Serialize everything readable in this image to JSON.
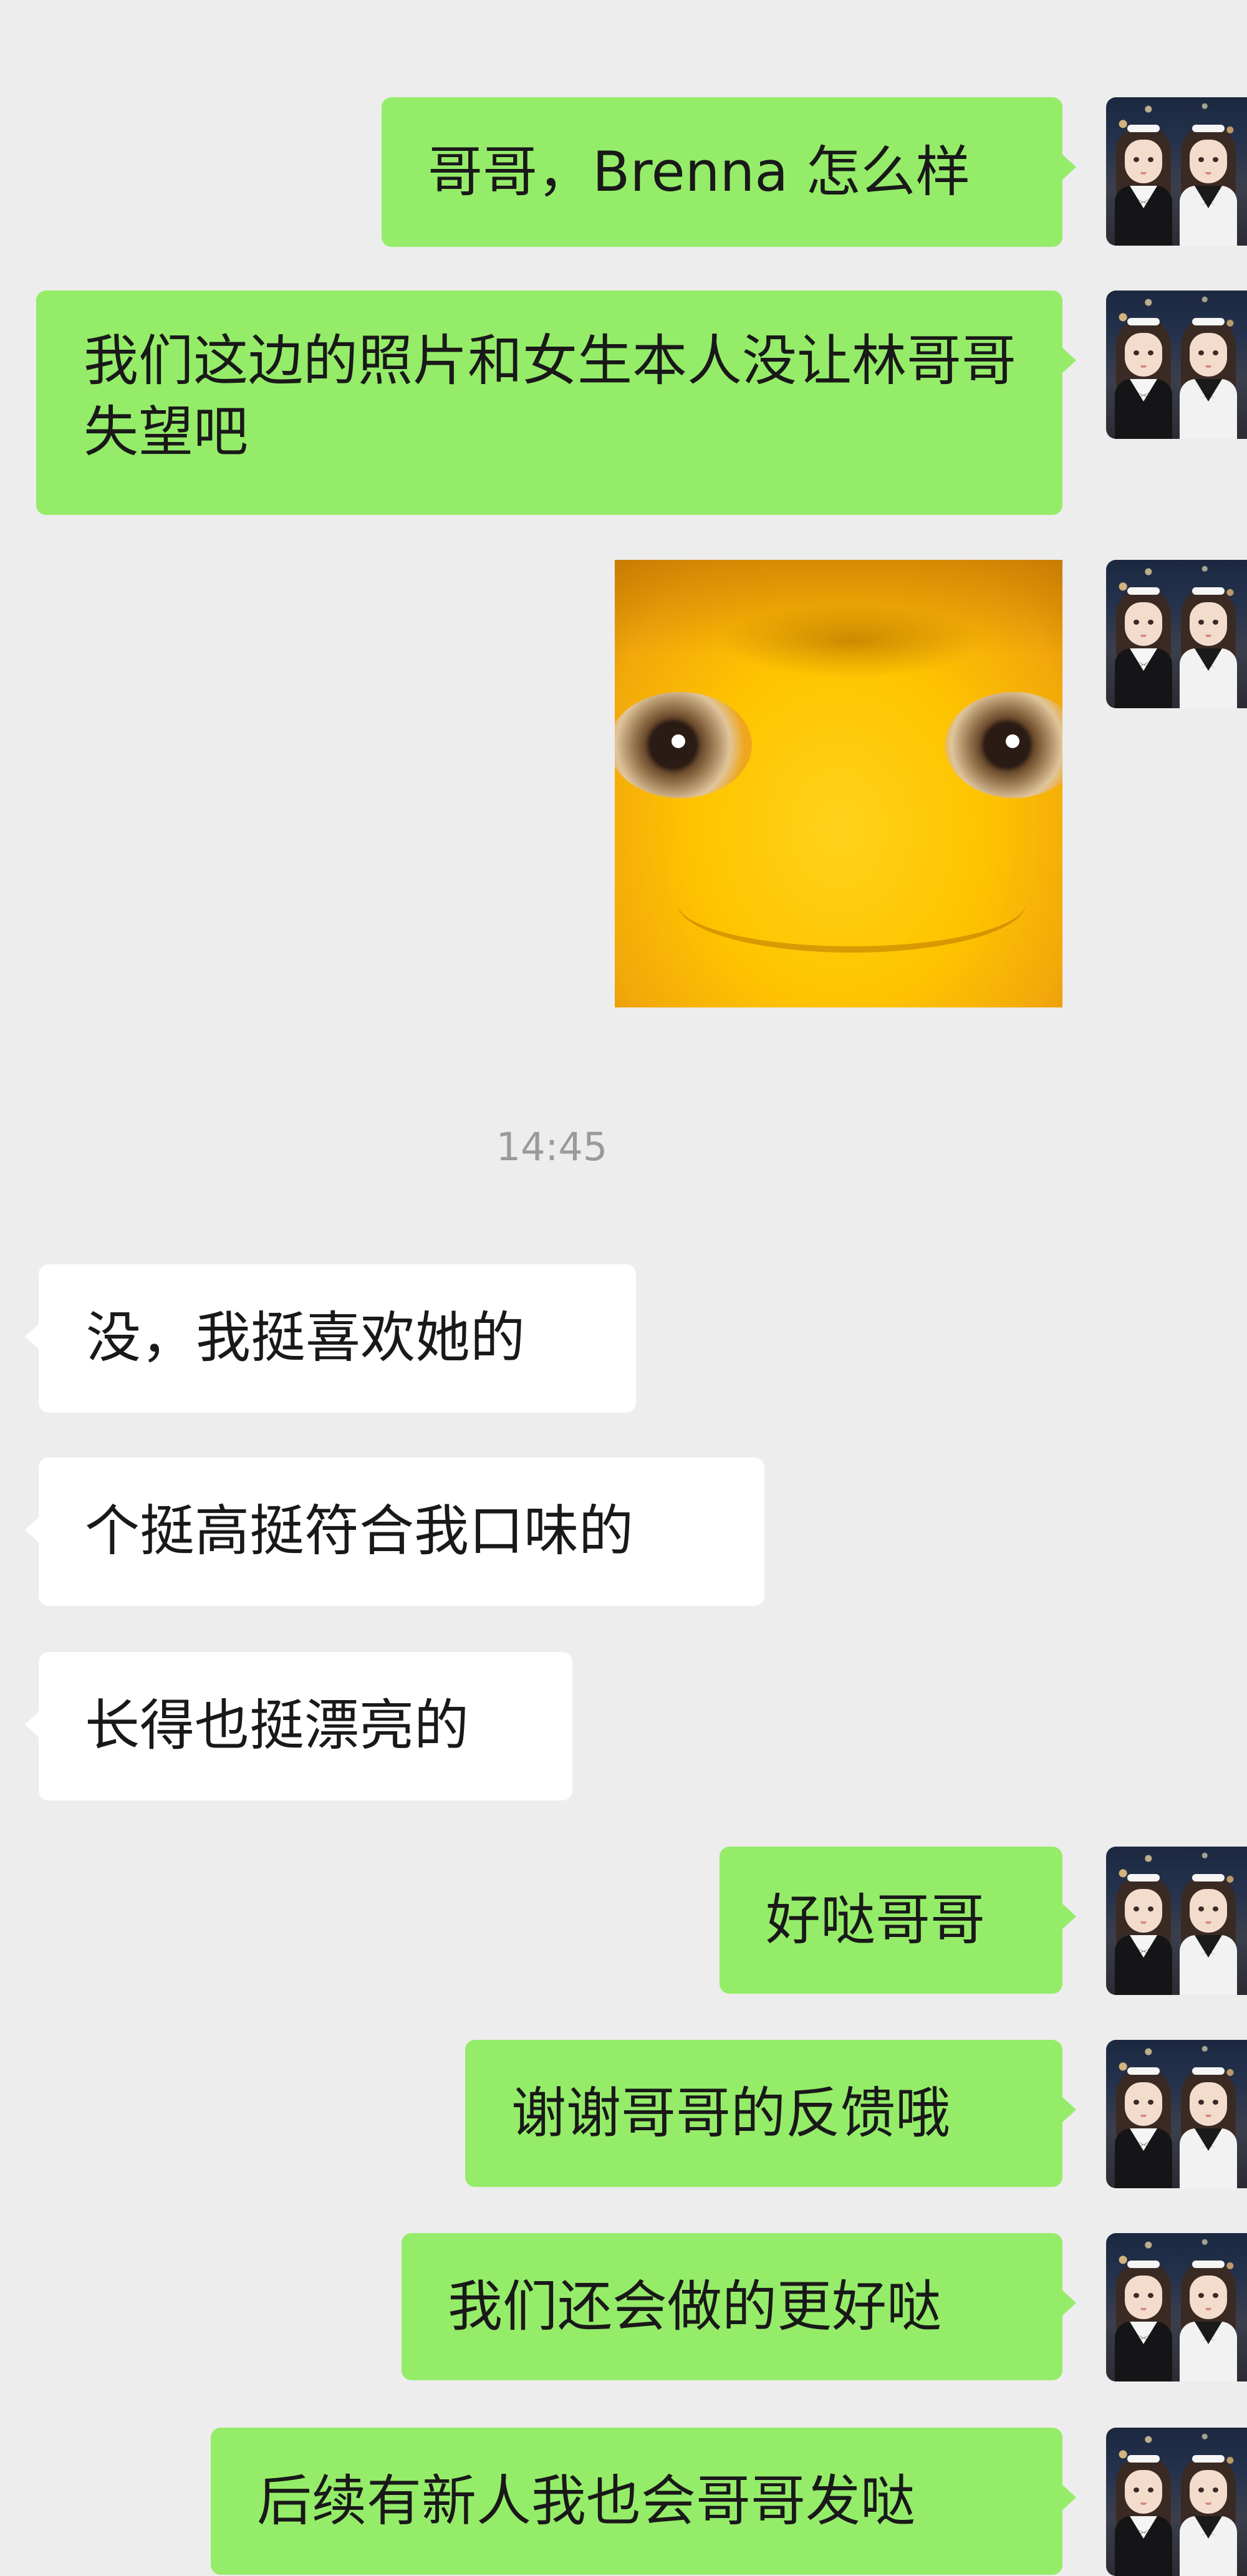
{
  "chat": {
    "messages": [
      {
        "id": "m1",
        "sender": "me",
        "text": "哥哥，Brenna 怎么样"
      },
      {
        "id": "m2",
        "sender": "me",
        "text": "我们这边的照片和女生本人没让林哥哥失望吧"
      },
      {
        "id": "m3",
        "sender": "me",
        "sticker": "yellow-face-sticker"
      },
      {
        "id": "m4",
        "sender": "other",
        "text": "没，我挺喜欢她的"
      },
      {
        "id": "m5",
        "sender": "other",
        "text": "个挺高挺符合我口味的"
      },
      {
        "id": "m6",
        "sender": "other",
        "text": "长得也挺漂亮的"
      },
      {
        "id": "m7",
        "sender": "me",
        "text": "好哒哥哥"
      },
      {
        "id": "m8",
        "sender": "me",
        "text": "谢谢哥哥的反馈哦"
      },
      {
        "id": "m9",
        "sender": "me",
        "text": "我们还会做的更好哒"
      },
      {
        "id": "m10",
        "sender": "me",
        "text": "后续有新人我也会哥哥发哒"
      }
    ],
    "timestamp": "14:45"
  },
  "colors": {
    "background": "#ededed",
    "my_bubble": "#95ec69",
    "other_bubble": "#ffffff",
    "timestamp_text": "#9a9a9a"
  },
  "icons": {
    "avatar": "avatar-two-girls",
    "sticker": "yellow-face-sticker"
  }
}
